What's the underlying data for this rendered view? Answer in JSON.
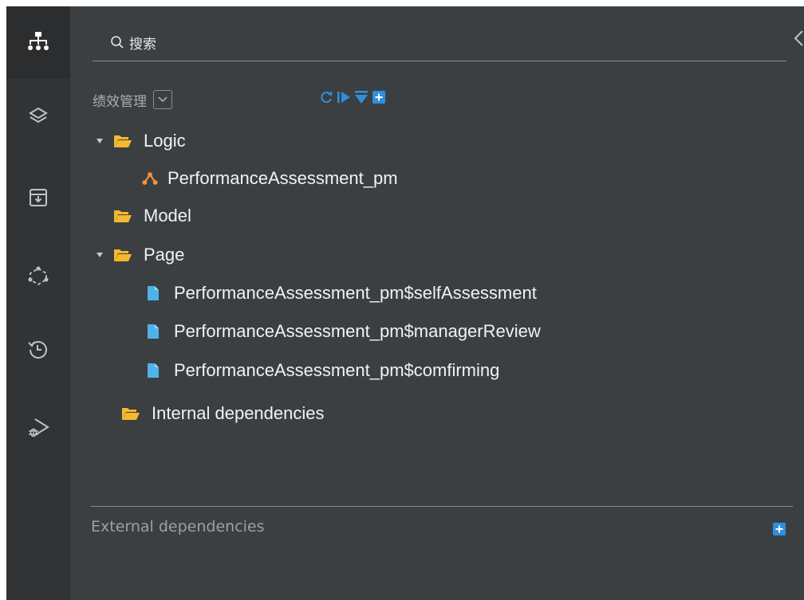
{
  "search": {
    "placeholder": "搜索"
  },
  "project": {
    "name": "绩效管理"
  },
  "toolbar": {
    "refresh_icon": "refresh-icon",
    "expand_icon": "expand-icon",
    "collapse_all_icon": "collapse-all-icon",
    "add_icon": "add-icon"
  },
  "activity_bar": [
    {
      "icon": "sitemap-icon",
      "active": true
    },
    {
      "icon": "layers-icon"
    },
    {
      "icon": "archive-download-icon"
    },
    {
      "icon": "network-icon"
    },
    {
      "icon": "history-icon"
    },
    {
      "icon": "debug-icon"
    }
  ],
  "tree": {
    "logic": {
      "label": "Logic",
      "expanded": true,
      "children": [
        {
          "label": "PerformanceAssessment_pm"
        }
      ]
    },
    "model": {
      "label": "Model"
    },
    "page": {
      "label": "Page",
      "expanded": true,
      "children": [
        {
          "label": "PerformanceAssessment_pm$selfAssessment"
        },
        {
          "label": "PerformanceAssessment_pm$managerReview"
        },
        {
          "label": "PerformanceAssessment_pm$comfirming"
        }
      ]
    },
    "internal": {
      "label": "Internal dependencies"
    }
  },
  "external": {
    "label": "External dependencies"
  },
  "colors": {
    "folder": "#f5b82e",
    "file": "#4fb3e8",
    "logic": "#f5943a",
    "accent": "#2f8fdd",
    "panel": "#3c3f41",
    "sidebar": "#313335"
  }
}
